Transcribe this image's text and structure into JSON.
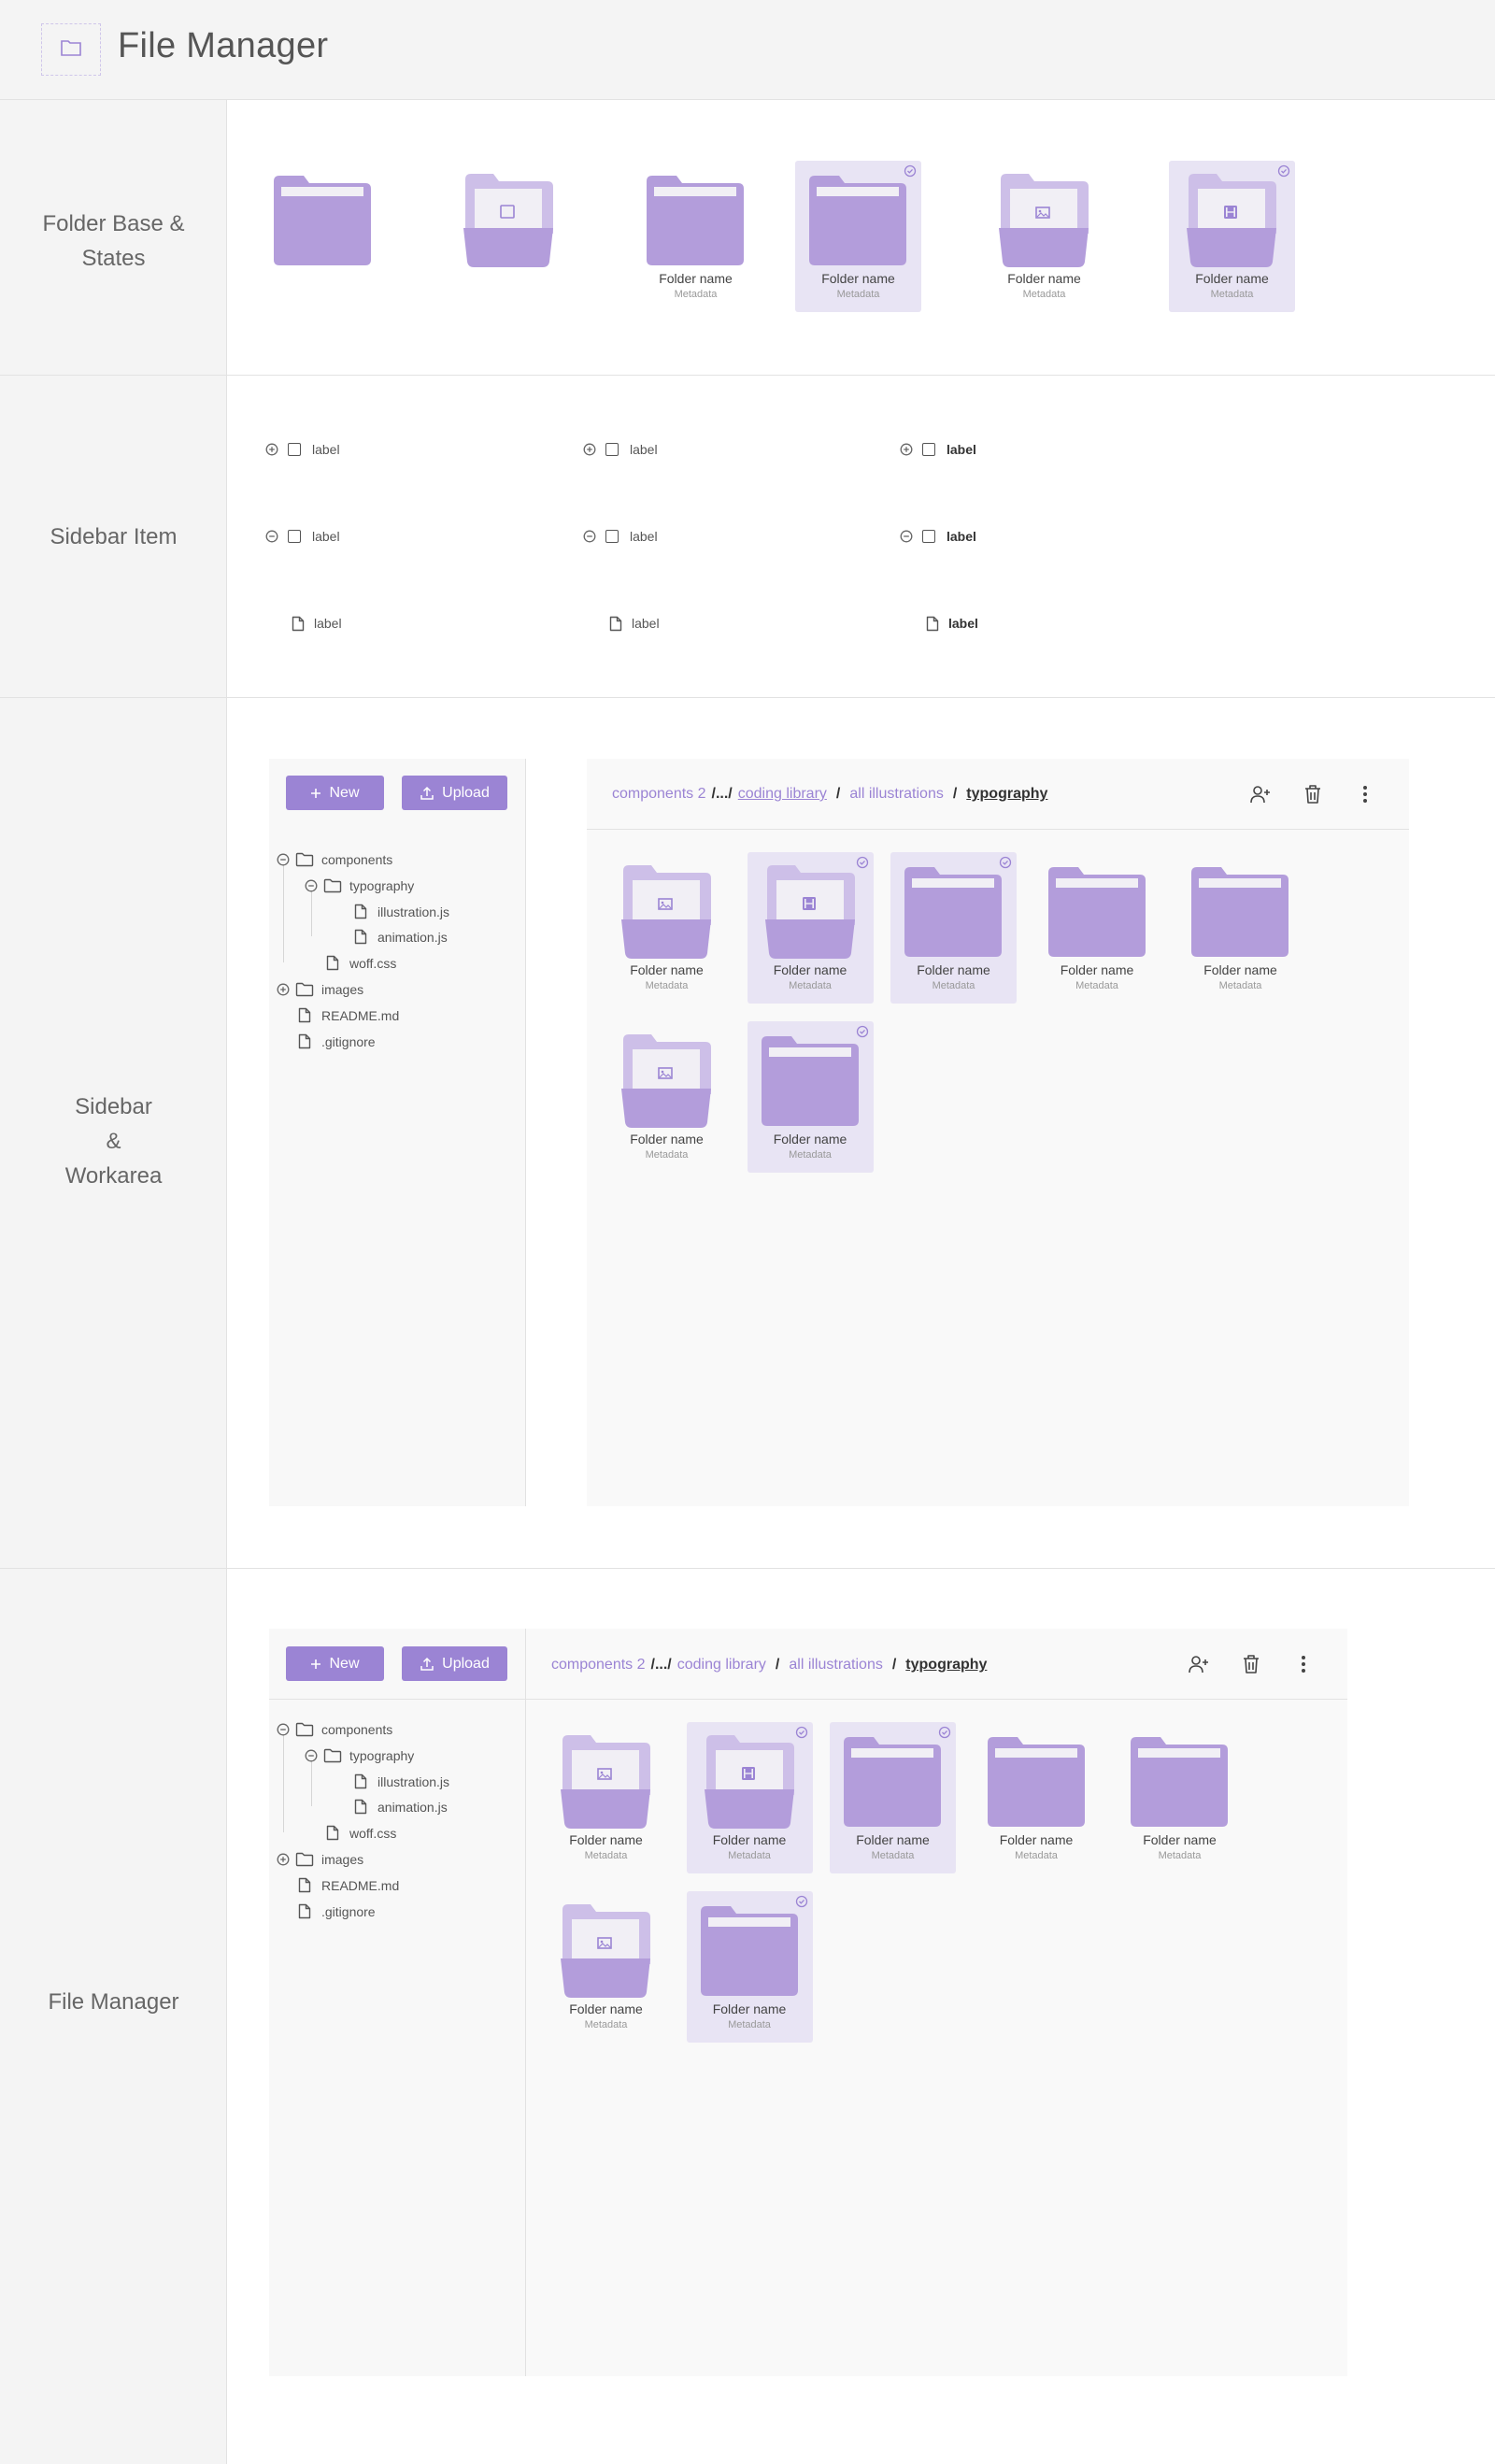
{
  "page": {
    "title": "File Manager"
  },
  "colors": {
    "accent": "#9b84d4",
    "folder": "#b39ddb",
    "folder_light": "#cdbfe8",
    "selected_bg": "#e8e4f4"
  },
  "sections": {
    "folder_states": {
      "label_line1": "Folder Base &",
      "label_line2": "States"
    },
    "sidebar_item": {
      "label": "Sidebar Item"
    },
    "sidebar_workarea": {
      "label_line1": "Sidebar",
      "label_line2": "&",
      "label_line3": "Workarea"
    },
    "file_manager": {
      "label": "File Manager"
    }
  },
  "folder_demo": {
    "tiles": [
      {
        "variant": "closed",
        "selected": false,
        "name": "",
        "meta": ""
      },
      {
        "variant": "open-blank",
        "selected": false,
        "name": "",
        "meta": ""
      },
      {
        "variant": "closed",
        "selected": false,
        "name": "Folder name",
        "meta": "Metadata"
      },
      {
        "variant": "closed",
        "selected": true,
        "name": "Folder name",
        "meta": "Metadata"
      },
      {
        "variant": "open-image",
        "selected": false,
        "name": "Folder name",
        "meta": "Metadata"
      },
      {
        "variant": "open-video",
        "selected": true,
        "name": "Folder name",
        "meta": "Metadata"
      }
    ]
  },
  "sidebar_items": {
    "label": "label",
    "rows": [
      {
        "type": "collapsed",
        "columns": [
          "normal",
          "normal",
          "bold"
        ]
      },
      {
        "type": "expanded",
        "columns": [
          "normal",
          "normal",
          "bold"
        ]
      },
      {
        "type": "file",
        "columns": [
          "normal",
          "normal",
          "bold"
        ]
      }
    ]
  },
  "file_manager": {
    "new_button": "New",
    "upload_button": "Upload",
    "breadcrumb": {
      "root": "components 2",
      "ellipsis": "/.../",
      "level1": "coding library",
      "level2": "all illustrations",
      "current": "typography",
      "separator": "/"
    },
    "toolbar": {
      "share_icon": "user-plus-icon",
      "delete_icon": "trash-icon",
      "more_icon": "more-vertical-icon"
    },
    "tree": [
      {
        "label": "components",
        "depth": 0,
        "kind": "folder",
        "state": "expanded"
      },
      {
        "label": "typography",
        "depth": 1,
        "kind": "folder",
        "state": "expanded"
      },
      {
        "label": "illustration.js",
        "depth": 2,
        "kind": "file"
      },
      {
        "label": "animation.js",
        "depth": 2,
        "kind": "file"
      },
      {
        "label": "woff.css",
        "depth": 1,
        "kind": "file"
      },
      {
        "label": "images",
        "depth": 0,
        "kind": "folder",
        "state": "collapsed"
      },
      {
        "label": "README.md",
        "depth": 0,
        "kind": "file"
      },
      {
        "label": ".gitignore",
        "depth": 0,
        "kind": "file"
      }
    ],
    "grid": [
      {
        "variant": "open-image",
        "selected": false,
        "name": "Folder name",
        "meta": "Metadata"
      },
      {
        "variant": "open-video",
        "selected": true,
        "name": "Folder name",
        "meta": "Metadata"
      },
      {
        "variant": "closed",
        "selected": true,
        "name": "Folder name",
        "meta": "Metadata"
      },
      {
        "variant": "closed",
        "selected": false,
        "name": "Folder name",
        "meta": "Metadata"
      },
      {
        "variant": "closed",
        "selected": false,
        "name": "Folder name",
        "meta": "Metadata"
      },
      {
        "variant": "open-image",
        "selected": false,
        "name": "Folder name",
        "meta": "Metadata"
      },
      {
        "variant": "closed",
        "selected": true,
        "name": "Folder name",
        "meta": "Metadata"
      }
    ]
  }
}
